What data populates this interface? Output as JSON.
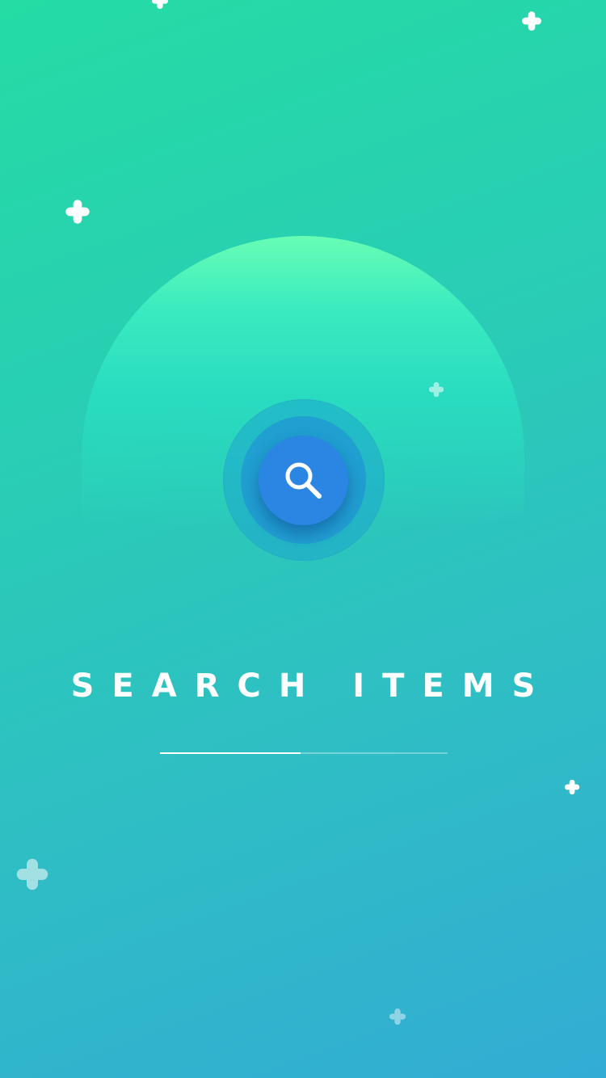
{
  "screen": {
    "title": "SEARCH ITEMS",
    "search_button_icon": "search-icon",
    "loading_progress": 0.49
  },
  "colors": {
    "background_top": "#24dca4",
    "background_bottom": "#32acd4",
    "arch_top": "#67fdb4",
    "button": "#2a86e2",
    "sparkle": "#ffffff"
  }
}
